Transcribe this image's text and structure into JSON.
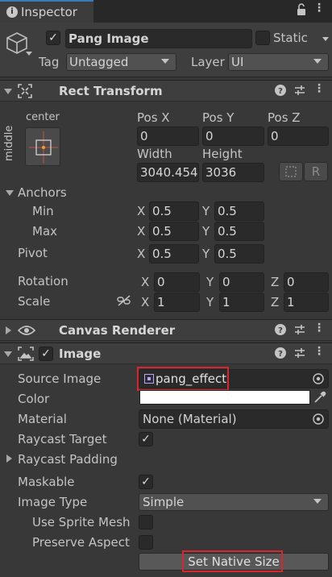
{
  "tab": {
    "title": "Inspector",
    "icon": "info-icon"
  },
  "header": {
    "object_name": "Pang Image",
    "active": true,
    "static_label": "Static",
    "static": false,
    "tag_label": "Tag",
    "tag_value": "Untagged",
    "layer_label": "Layer",
    "layer_value": "UI"
  },
  "rect_transform": {
    "title": "Rect Transform",
    "anchor_preset_h": "center",
    "anchor_preset_v": "middle",
    "pos_x_label": "Pos X",
    "pos_y_label": "Pos Y",
    "pos_z_label": "Pos Z",
    "pos_x": "0",
    "pos_y": "0",
    "pos_z": "0",
    "width_label": "Width",
    "height_label": "Height",
    "width": "3040.454",
    "height": "3036",
    "raw_label": "R",
    "anchors_label": "Anchors",
    "min_label": "Min",
    "max_label": "Max",
    "min_x": "0.5",
    "min_y": "0.5",
    "max_x": "0.5",
    "max_y": "0.5",
    "pivot_label": "Pivot",
    "pivot_x": "0.5",
    "pivot_y": "0.5",
    "rotation_label": "Rotation",
    "rot_x": "0",
    "rot_y": "0",
    "rot_z": "0",
    "scale_label": "Scale",
    "scale_x": "1",
    "scale_y": "1",
    "scale_z": "1",
    "axis_x": "X",
    "axis_y": "Y",
    "axis_z": "Z"
  },
  "canvas_renderer": {
    "title": "Canvas Renderer"
  },
  "image": {
    "title": "Image",
    "enabled": true,
    "source_image_label": "Source Image",
    "source_image_value": "pang_effect",
    "color_label": "Color",
    "color_value": "#ffffff",
    "material_label": "Material",
    "material_value": "None (Material)",
    "raycast_target_label": "Raycast Target",
    "raycast_target": true,
    "raycast_padding_label": "Raycast Padding",
    "maskable_label": "Maskable",
    "maskable": true,
    "image_type_label": "Image Type",
    "image_type_value": "Simple",
    "use_sprite_mesh_label": "Use Sprite Mesh",
    "use_sprite_mesh": false,
    "preserve_aspect_label": "Preserve Aspect",
    "preserve_aspect": false,
    "set_native_size_label": "Set Native Size"
  },
  "colors": {
    "panel": "#383838",
    "header": "#3e3e3e",
    "highlight": "#d8262f",
    "anchor_dot": "#f0a020"
  }
}
